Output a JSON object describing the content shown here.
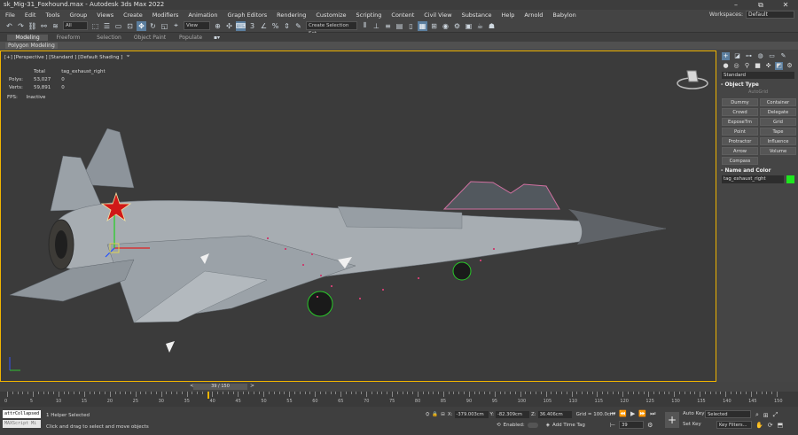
{
  "window": {
    "title": "sk_Mig-31_Foxhound.max - Autodesk 3ds Max 2022",
    "controls": [
      "–",
      "⧉",
      "✕"
    ]
  },
  "menu": [
    "File",
    "Edit",
    "Tools",
    "Group",
    "Views",
    "Create",
    "Modifiers",
    "Animation",
    "Graph Editors",
    "Rendering",
    "Customize",
    "Scripting",
    "Content",
    "Civil View",
    "Substance",
    "Help",
    "Arnold",
    "Babylon"
  ],
  "workspaces": {
    "label": "Workspaces:",
    "value": "Default"
  },
  "toolbar": {
    "filter": "All",
    "refcoord": "View",
    "selset": "Create Selection Set"
  },
  "ribbon": {
    "tabs": [
      "Modeling",
      "Freeform",
      "Selection",
      "Object Paint",
      "Populate"
    ],
    "sub": "Polygon Modeling"
  },
  "viewport": {
    "label": "[+] [Perspective ] [Standard ] [Default Shading ]",
    "stats": {
      "h1": "Total",
      "h2": "tag_exhaust_right",
      "polys_l": "Polys:",
      "polys_t": "53,027",
      "polys_s": "0",
      "verts_l": "Verts:",
      "verts_t": "59,891",
      "verts_s": "0"
    },
    "fps_l": "FPS:",
    "fps_v": "Inactive"
  },
  "command_panel": {
    "category": "Standard",
    "rollout1": "Object Type",
    "autogrid": "AutoGrid",
    "buttons": [
      "Dummy",
      "Container",
      "Crowd",
      "Delegate",
      "ExposeTm",
      "Grid",
      "Point",
      "Tape",
      "Protractor",
      "Influence",
      "Arrow",
      "Volume",
      "Compass"
    ],
    "rollout2": "Name and Color",
    "object_name": "tag_exhaust_right",
    "object_color": "#1ee61e"
  },
  "timeslider": {
    "value": "39 / 150",
    "frame": 39,
    "total": 150
  },
  "trackbar": {
    "ticks": [
      "0",
      "5",
      "10",
      "15",
      "20",
      "25",
      "30",
      "35",
      "40",
      "45",
      "50",
      "55",
      "60",
      "65",
      "70",
      "75",
      "80",
      "85",
      "90",
      "95",
      "100",
      "105",
      "110",
      "115",
      "120",
      "125",
      "130",
      "135",
      "140",
      "145",
      "150"
    ]
  },
  "status": {
    "maxscript1": "attrCollapsed",
    "maxscript2": "MAXScript Mi",
    "selection": "1 Helper Selected",
    "prompt": "Click and drag to select and move objects",
    "x": "-379.003cm",
    "y": "-82.309cm",
    "z": "36.406cm",
    "grid": "Grid = 100.0cm",
    "enabled": "Enabled:",
    "addtimetag": "Add Time Tag",
    "autokey": "Auto Key",
    "setkey": "Set Key",
    "selected": "Selected",
    "keyfilters": "Key Filters...",
    "frame": "39"
  },
  "colors": {
    "accent": "#5b7e9e",
    "viewport_border": "#f0b400"
  }
}
